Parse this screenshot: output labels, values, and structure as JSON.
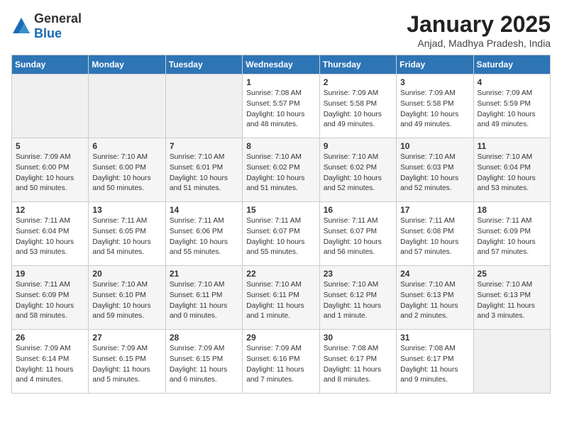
{
  "logo": {
    "general": "General",
    "blue": "Blue"
  },
  "title": "January 2025",
  "location": "Anjad, Madhya Pradesh, India",
  "days_of_week": [
    "Sunday",
    "Monday",
    "Tuesday",
    "Wednesday",
    "Thursday",
    "Friday",
    "Saturday"
  ],
  "weeks": [
    [
      {
        "day": "",
        "info": ""
      },
      {
        "day": "",
        "info": ""
      },
      {
        "day": "",
        "info": ""
      },
      {
        "day": "1",
        "info": "Sunrise: 7:08 AM\nSunset: 5:57 PM\nDaylight: 10 hours\nand 48 minutes."
      },
      {
        "day": "2",
        "info": "Sunrise: 7:09 AM\nSunset: 5:58 PM\nDaylight: 10 hours\nand 49 minutes."
      },
      {
        "day": "3",
        "info": "Sunrise: 7:09 AM\nSunset: 5:58 PM\nDaylight: 10 hours\nand 49 minutes."
      },
      {
        "day": "4",
        "info": "Sunrise: 7:09 AM\nSunset: 5:59 PM\nDaylight: 10 hours\nand 49 minutes."
      }
    ],
    [
      {
        "day": "5",
        "info": "Sunrise: 7:09 AM\nSunset: 6:00 PM\nDaylight: 10 hours\nand 50 minutes."
      },
      {
        "day": "6",
        "info": "Sunrise: 7:10 AM\nSunset: 6:00 PM\nDaylight: 10 hours\nand 50 minutes."
      },
      {
        "day": "7",
        "info": "Sunrise: 7:10 AM\nSunset: 6:01 PM\nDaylight: 10 hours\nand 51 minutes."
      },
      {
        "day": "8",
        "info": "Sunrise: 7:10 AM\nSunset: 6:02 PM\nDaylight: 10 hours\nand 51 minutes."
      },
      {
        "day": "9",
        "info": "Sunrise: 7:10 AM\nSunset: 6:02 PM\nDaylight: 10 hours\nand 52 minutes."
      },
      {
        "day": "10",
        "info": "Sunrise: 7:10 AM\nSunset: 6:03 PM\nDaylight: 10 hours\nand 52 minutes."
      },
      {
        "day": "11",
        "info": "Sunrise: 7:10 AM\nSunset: 6:04 PM\nDaylight: 10 hours\nand 53 minutes."
      }
    ],
    [
      {
        "day": "12",
        "info": "Sunrise: 7:11 AM\nSunset: 6:04 PM\nDaylight: 10 hours\nand 53 minutes."
      },
      {
        "day": "13",
        "info": "Sunrise: 7:11 AM\nSunset: 6:05 PM\nDaylight: 10 hours\nand 54 minutes."
      },
      {
        "day": "14",
        "info": "Sunrise: 7:11 AM\nSunset: 6:06 PM\nDaylight: 10 hours\nand 55 minutes."
      },
      {
        "day": "15",
        "info": "Sunrise: 7:11 AM\nSunset: 6:07 PM\nDaylight: 10 hours\nand 55 minutes."
      },
      {
        "day": "16",
        "info": "Sunrise: 7:11 AM\nSunset: 6:07 PM\nDaylight: 10 hours\nand 56 minutes."
      },
      {
        "day": "17",
        "info": "Sunrise: 7:11 AM\nSunset: 6:08 PM\nDaylight: 10 hours\nand 57 minutes."
      },
      {
        "day": "18",
        "info": "Sunrise: 7:11 AM\nSunset: 6:09 PM\nDaylight: 10 hours\nand 57 minutes."
      }
    ],
    [
      {
        "day": "19",
        "info": "Sunrise: 7:11 AM\nSunset: 6:09 PM\nDaylight: 10 hours\nand 58 minutes."
      },
      {
        "day": "20",
        "info": "Sunrise: 7:10 AM\nSunset: 6:10 PM\nDaylight: 10 hours\nand 59 minutes."
      },
      {
        "day": "21",
        "info": "Sunrise: 7:10 AM\nSunset: 6:11 PM\nDaylight: 11 hours\nand 0 minutes."
      },
      {
        "day": "22",
        "info": "Sunrise: 7:10 AM\nSunset: 6:11 PM\nDaylight: 11 hours\nand 1 minute."
      },
      {
        "day": "23",
        "info": "Sunrise: 7:10 AM\nSunset: 6:12 PM\nDaylight: 11 hours\nand 1 minute."
      },
      {
        "day": "24",
        "info": "Sunrise: 7:10 AM\nSunset: 6:13 PM\nDaylight: 11 hours\nand 2 minutes."
      },
      {
        "day": "25",
        "info": "Sunrise: 7:10 AM\nSunset: 6:13 PM\nDaylight: 11 hours\nand 3 minutes."
      }
    ],
    [
      {
        "day": "26",
        "info": "Sunrise: 7:09 AM\nSunset: 6:14 PM\nDaylight: 11 hours\nand 4 minutes."
      },
      {
        "day": "27",
        "info": "Sunrise: 7:09 AM\nSunset: 6:15 PM\nDaylight: 11 hours\nand 5 minutes."
      },
      {
        "day": "28",
        "info": "Sunrise: 7:09 AM\nSunset: 6:15 PM\nDaylight: 11 hours\nand 6 minutes."
      },
      {
        "day": "29",
        "info": "Sunrise: 7:09 AM\nSunset: 6:16 PM\nDaylight: 11 hours\nand 7 minutes."
      },
      {
        "day": "30",
        "info": "Sunrise: 7:08 AM\nSunset: 6:17 PM\nDaylight: 11 hours\nand 8 minutes."
      },
      {
        "day": "31",
        "info": "Sunrise: 7:08 AM\nSunset: 6:17 PM\nDaylight: 11 hours\nand 9 minutes."
      },
      {
        "day": "",
        "info": ""
      }
    ]
  ]
}
